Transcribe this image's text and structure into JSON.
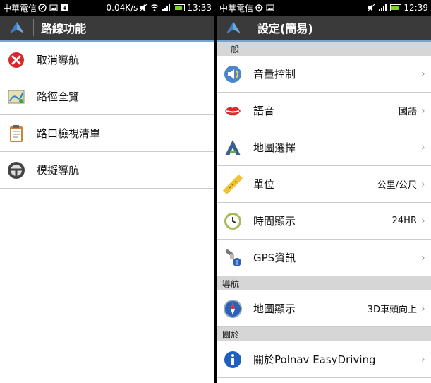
{
  "left": {
    "status": {
      "carrier": "中華電信",
      "speed": "0.04K/s",
      "time": "13:33"
    },
    "title": "路線功能",
    "items": [
      {
        "label": "取消導航",
        "icon": "cancel-icon"
      },
      {
        "label": "路徑全覽",
        "icon": "route-overview-icon"
      },
      {
        "label": "路口檢視清單",
        "icon": "clipboard-icon"
      },
      {
        "label": "模擬導航",
        "icon": "steering-wheel-icon"
      }
    ]
  },
  "right": {
    "status": {
      "carrier": "中華電信",
      "time": "12:39"
    },
    "title": "設定(簡易)",
    "sections": [
      {
        "header": "一般",
        "items": [
          {
            "label": "音量控制",
            "value": "",
            "icon": "speaker-icon"
          },
          {
            "label": "語音",
            "value": "國語",
            "icon": "lips-icon"
          },
          {
            "label": "地圖選擇",
            "value": "",
            "icon": "map-select-icon"
          },
          {
            "label": "單位",
            "value": "公里/公尺",
            "icon": "ruler-icon"
          },
          {
            "label": "時間顯示",
            "value": "24HR",
            "icon": "clock-icon"
          },
          {
            "label": "GPS資訊",
            "value": "",
            "icon": "satellite-icon"
          }
        ]
      },
      {
        "header": "導航",
        "items": [
          {
            "label": "地圖顯示",
            "value": "3D車頭向上",
            "icon": "compass-icon"
          }
        ]
      },
      {
        "header": "關於",
        "items": [
          {
            "label": "關於Polnav EasyDriving",
            "value": "",
            "icon": "info-icon"
          }
        ]
      }
    ]
  },
  "colors": {
    "accent": "#6ea8d8",
    "titlebar": "#3a3a3a",
    "section": "#d6d6d6"
  }
}
